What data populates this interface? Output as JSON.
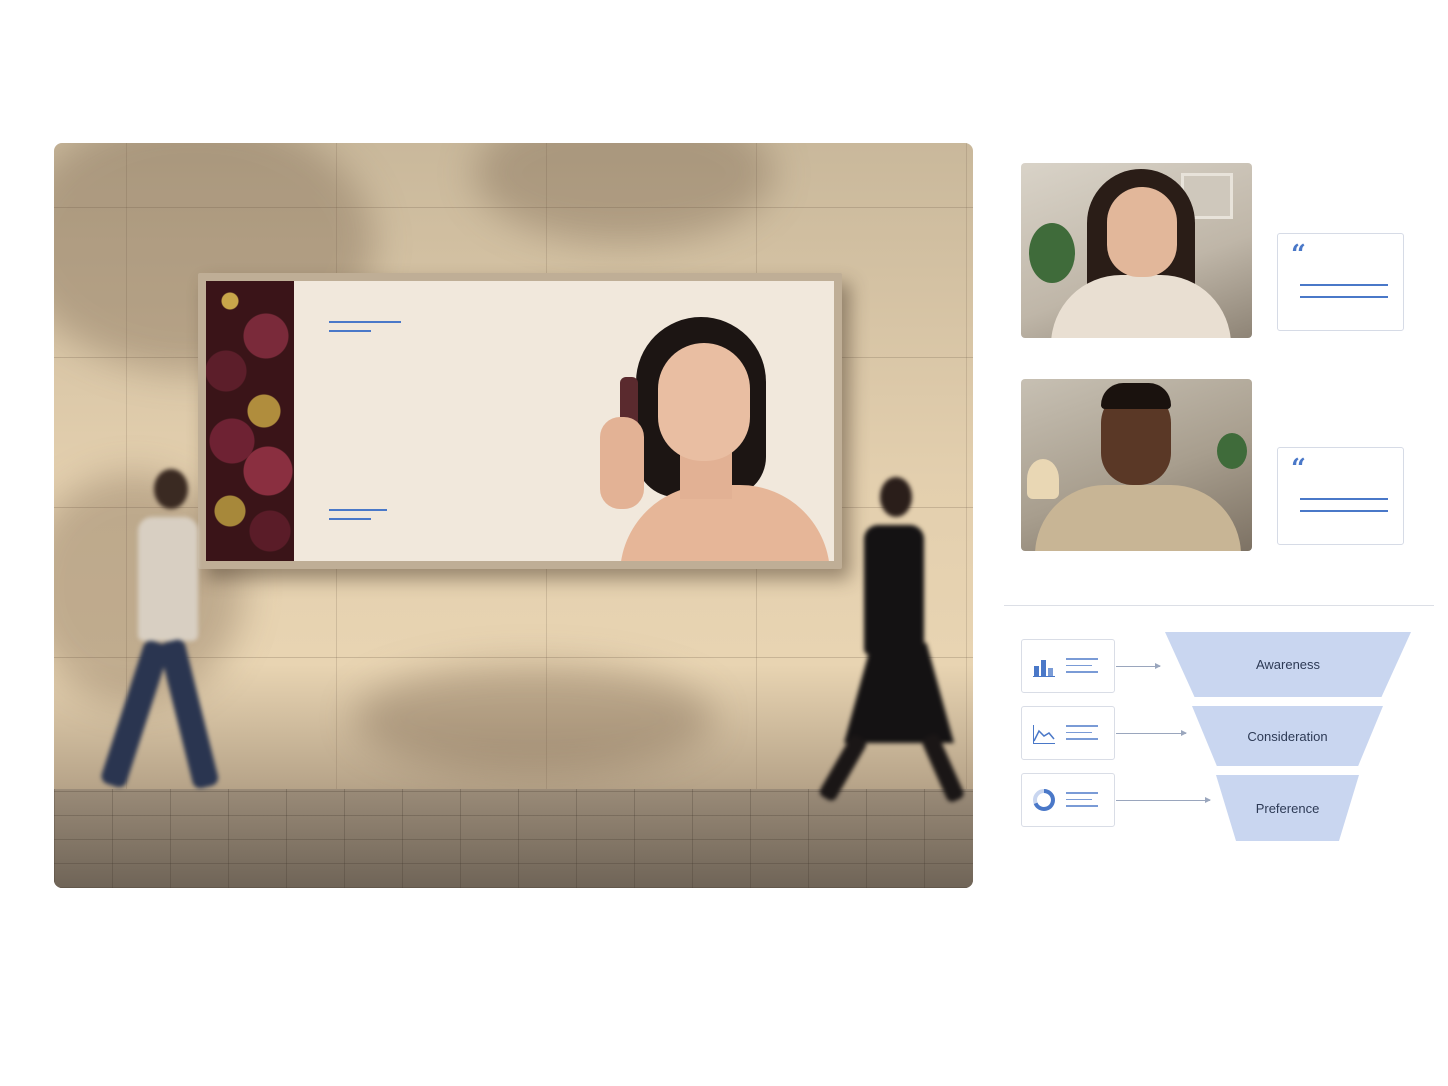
{
  "funnel": {
    "stages": [
      {
        "label": "Awareness"
      },
      {
        "label": "Consideration"
      },
      {
        "label": "Preference"
      }
    ],
    "metric_icons": [
      "bar-chart-icon",
      "line-chart-icon",
      "donut-chart-icon"
    ]
  },
  "testimonials": {
    "quote_glyph": "“"
  },
  "colors": {
    "accent": "#4a78c8",
    "funnel_fill": "#c9d6f0",
    "card_border": "#d6dbe6"
  }
}
